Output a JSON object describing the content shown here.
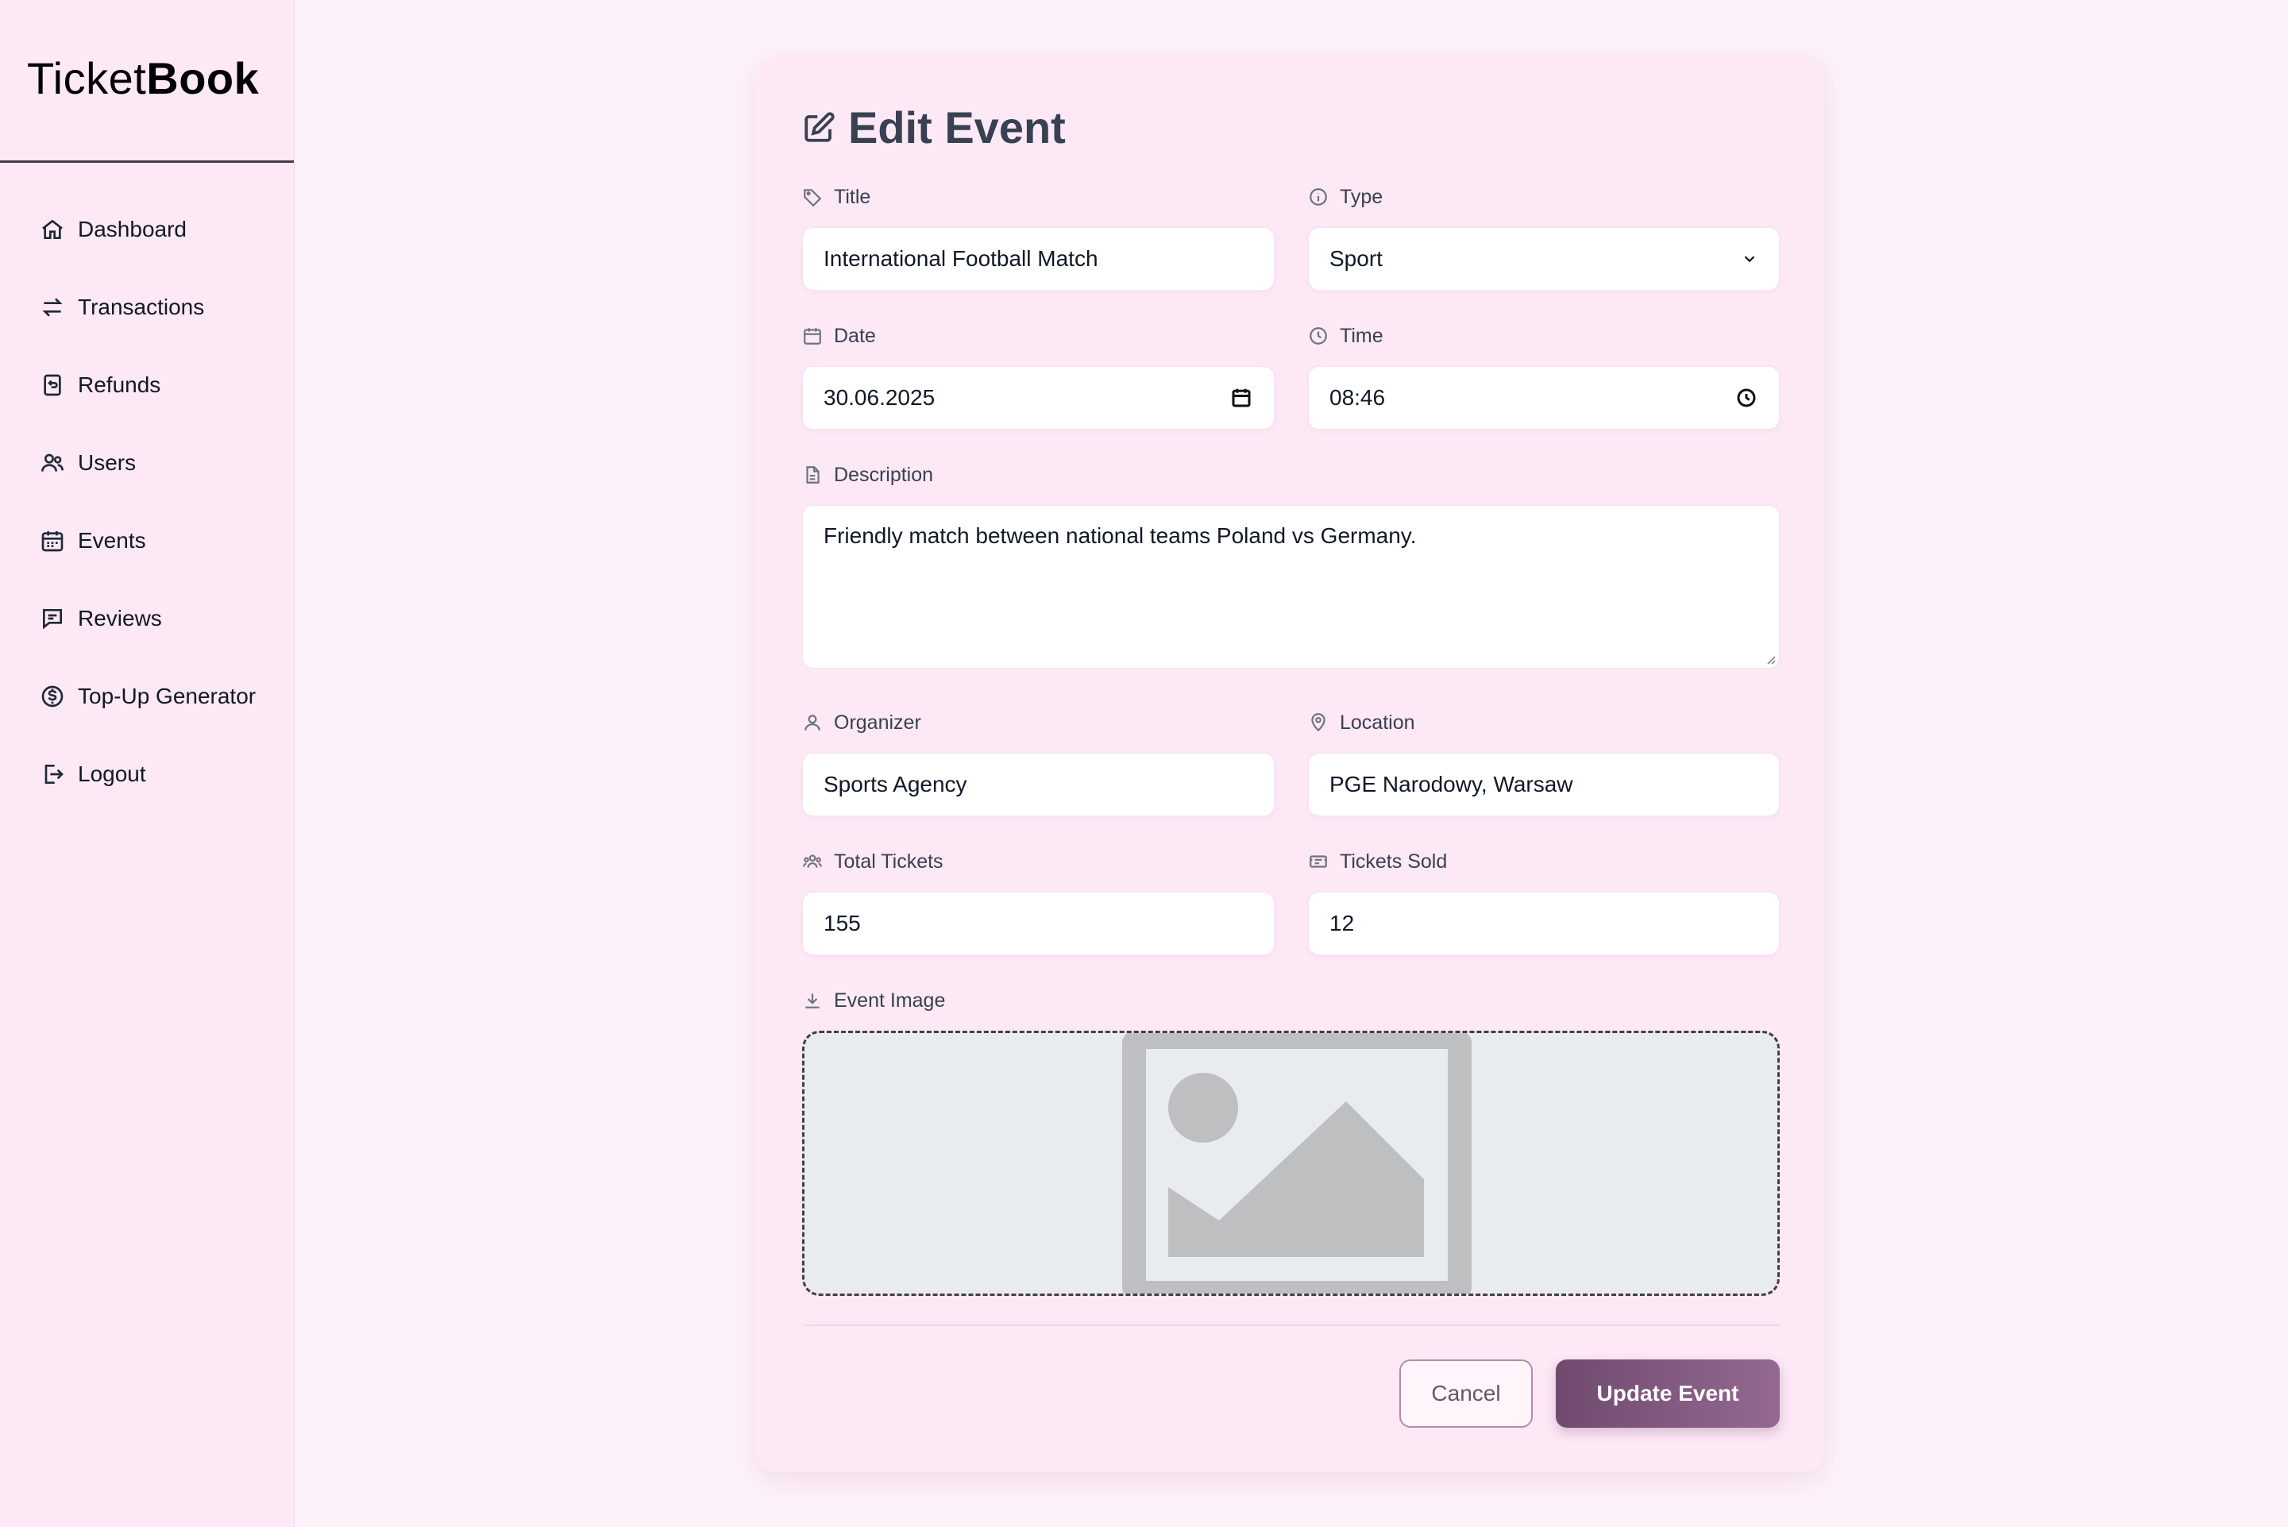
{
  "app": {
    "logo_light": "Ticket",
    "logo_bold": "Book"
  },
  "sidebar": {
    "items": [
      {
        "label": "Dashboard",
        "icon": "home-icon"
      },
      {
        "label": "Transactions",
        "icon": "arrows-swap-icon"
      },
      {
        "label": "Refunds",
        "icon": "receipt-refund-icon"
      },
      {
        "label": "Users",
        "icon": "users-icon"
      },
      {
        "label": "Events",
        "icon": "calendar-icon"
      },
      {
        "label": "Reviews",
        "icon": "chat-icon"
      },
      {
        "label": "Top-Up Generator",
        "icon": "dollar-circle-icon"
      },
      {
        "label": "Logout",
        "icon": "logout-icon"
      }
    ]
  },
  "form": {
    "title": "Edit Event",
    "fields": {
      "title": {
        "label": "Title",
        "value": "International Football Match"
      },
      "type": {
        "label": "Type",
        "value": "Sport"
      },
      "date": {
        "label": "Date",
        "value": "30.06.2025"
      },
      "time": {
        "label": "Time",
        "value": "08:46"
      },
      "description": {
        "label": "Description",
        "value": "Friendly match between national teams Poland vs Germany."
      },
      "organizer": {
        "label": "Organizer",
        "value": "Sports Agency"
      },
      "location": {
        "label": "Location",
        "value": "PGE Narodowy, Warsaw"
      },
      "total_tickets": {
        "label": "Total Tickets",
        "value": "155"
      },
      "tickets_sold": {
        "label": "Tickets Sold",
        "value": "12"
      },
      "event_image": {
        "label": "Event Image"
      }
    },
    "buttons": {
      "cancel": "Cancel",
      "update": "Update Event"
    }
  },
  "colors": {
    "page_bg": "#fdf1fa",
    "sidebar_bg": "#fde8f5",
    "card_bg": "#fde8f6",
    "accent": "#7a5278"
  }
}
